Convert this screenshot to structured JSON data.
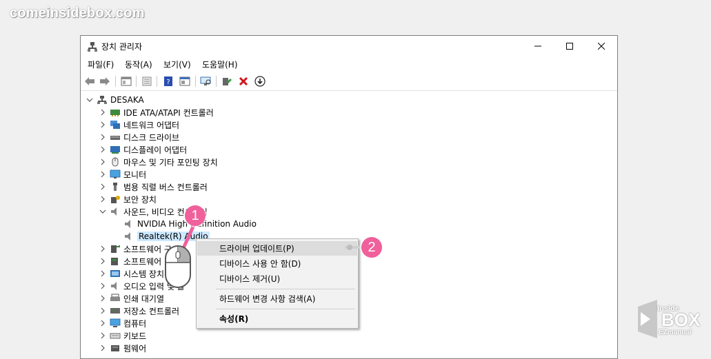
{
  "watermark": {
    "site": "comeinsidebox.com",
    "logo_top": "Inside",
    "logo_main": "BOX",
    "logo_sub": "EZmanual"
  },
  "window": {
    "title": "장치 관리자",
    "menu": [
      "파일(F)",
      "동작(A)",
      "보기(V)",
      "도움말(H)"
    ]
  },
  "tree": {
    "root": "DESAKA",
    "items": [
      {
        "label": "IDE ATA/ATAPI 컨트롤러",
        "icon": "ide-controller-icon"
      },
      {
        "label": "네트워크 어댑터",
        "icon": "network-adapter-icon"
      },
      {
        "label": "디스크 드라이브",
        "icon": "disk-drive-icon"
      },
      {
        "label": "디스플레이 어댑터",
        "icon": "display-adapter-icon"
      },
      {
        "label": "마우스 및 기타 포인팅 장치",
        "icon": "mouse-device-icon"
      },
      {
        "label": "모니터",
        "icon": "monitor-icon"
      },
      {
        "label": "범용 직렬 버스 컨트롤러",
        "icon": "usb-controller-icon"
      },
      {
        "label": "보안 장치",
        "icon": "security-device-icon"
      },
      {
        "label": "사운드, 비디오 컨트롤러",
        "icon": "sound-controller-icon",
        "expanded": true
      },
      {
        "label": "소프트웨어 구",
        "icon": "software-component-icon"
      },
      {
        "label": "소프트웨어",
        "icon": "software-device-icon"
      },
      {
        "label": "시스템 장치",
        "icon": "system-device-icon"
      },
      {
        "label": "오디오 입력 및 출",
        "icon": "audio-io-icon"
      },
      {
        "label": "인쇄 대기열",
        "icon": "print-queue-icon"
      },
      {
        "label": "저장소 컨트롤러",
        "icon": "storage-controller-icon"
      },
      {
        "label": "컴퓨터",
        "icon": "computer-icon"
      },
      {
        "label": "키보드",
        "icon": "keyboard-icon"
      },
      {
        "label": "펌웨어",
        "icon": "firmware-icon"
      }
    ],
    "sound_children": [
      "NVIDIA High Definition Audio",
      "Realtek(R) Audio"
    ]
  },
  "context_menu": {
    "items": [
      "드라이버 업데이트(P)",
      "디바이스 사용 안 함(D)",
      "디바이스 제거(U)",
      "하드웨어 변경 사항 검색(A)",
      "속성(R)"
    ],
    "highlighted": 0
  },
  "markers": [
    "1",
    "2"
  ],
  "colors": {
    "marker": "#f0609b",
    "selection": "#cce8ff"
  }
}
